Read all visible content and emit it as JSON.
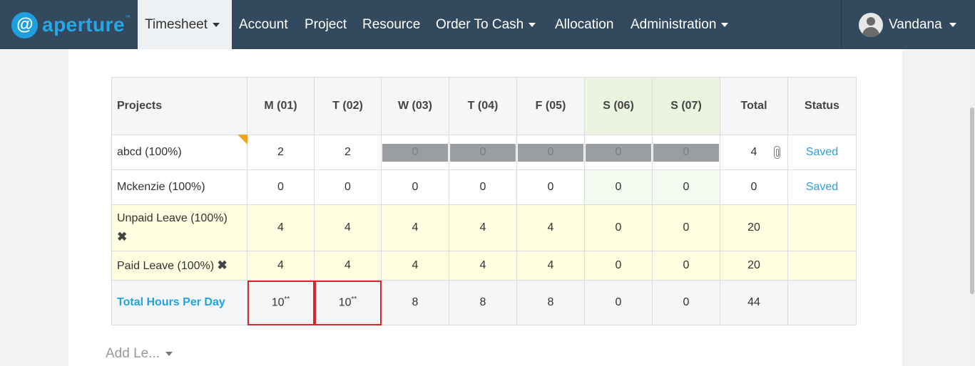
{
  "brand": {
    "logo_glyph": "@",
    "name": "aperture",
    "tm": "™"
  },
  "nav": {
    "timesheet": "Timesheet",
    "account": "Account",
    "project": "Project",
    "resource": "Resource",
    "order_to_cash": "Order To Cash",
    "allocation": "Allocation",
    "administration": "Administration"
  },
  "user": {
    "name": "Vandana"
  },
  "table": {
    "headers": [
      "Projects",
      "M (01)",
      "T (02)",
      "W (03)",
      "T (04)",
      "F (05)",
      "S (06)",
      "S (07)",
      "Total",
      "Status"
    ],
    "rows": [
      {
        "project": "abcd (100%)",
        "days": [
          "2",
          "2",
          "0",
          "0",
          "0",
          "0",
          "0"
        ],
        "total": "4",
        "status": "Saved"
      },
      {
        "project": "Mckenzie (100%)",
        "days": [
          "0",
          "0",
          "0",
          "0",
          "0",
          "0",
          "0"
        ],
        "total": "0",
        "status": "Saved"
      },
      {
        "project": "Unpaid Leave (100%)",
        "days": [
          "4",
          "4",
          "4",
          "4",
          "4",
          "0",
          "0"
        ],
        "total": "20",
        "status": ""
      },
      {
        "project": "Paid Leave (100%)",
        "days": [
          "4",
          "4",
          "4",
          "4",
          "4",
          "0",
          "0"
        ],
        "total": "20",
        "status": ""
      }
    ],
    "totals": {
      "label": "Total Hours Per Day",
      "days": [
        "10",
        "10",
        "8",
        "8",
        "8",
        "0",
        "0"
      ],
      "flag": "**",
      "total": "44"
    }
  },
  "add_leave": {
    "label": "Add Le..."
  },
  "colors": {
    "nav_bg": "#334a5e",
    "accent": "#1fa3e6",
    "leave_row": "#fefee1",
    "weekend_header": "#ecf4e1",
    "error_outline": "#d9262a"
  },
  "icons": {
    "remove": "close-x-icon",
    "attachment": "paperclip-icon",
    "user": "user-avatar-icon"
  }
}
